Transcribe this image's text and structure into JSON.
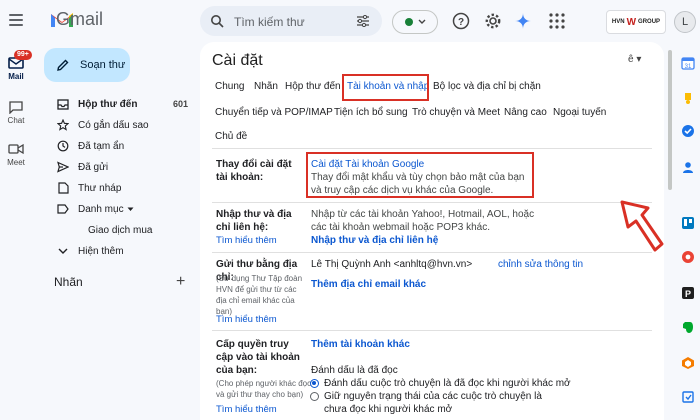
{
  "app": {
    "name": "Gmail"
  },
  "rail": {
    "mail_label": "Mail",
    "mail_badge": "99+",
    "chat_label": "Chat",
    "meet_label": "Meet"
  },
  "search": {
    "placeholder": "Tìm kiếm thư"
  },
  "brand": {
    "left": "HVN",
    "right": "GROUP"
  },
  "avatar": {
    "initial": "L"
  },
  "sidebar": {
    "compose": "Soạn thư",
    "items": [
      {
        "label": "Hộp thư đến",
        "count": "601",
        "icon": "inbox-icon"
      },
      {
        "label": "Có gắn dấu sao",
        "count": "",
        "icon": "star-icon"
      },
      {
        "label": "Đã tạm ẩn",
        "count": "",
        "icon": "clock-icon"
      },
      {
        "label": "Đã gửi",
        "count": "",
        "icon": "send-icon"
      },
      {
        "label": "Thư nháp",
        "count": "",
        "icon": "draft-icon"
      },
      {
        "label": "Danh mục",
        "count": "",
        "icon": "label-icon"
      },
      {
        "label": "Giao dịch mua",
        "count": "",
        "icon": "tag-icon"
      },
      {
        "label": "Hiện thêm",
        "count": "",
        "icon": "chevron-down-icon"
      }
    ],
    "labels_heading": "Nhãn"
  },
  "settings": {
    "title": "Cài đặt",
    "tabs_row1": [
      "Chung",
      "Nhãn",
      "Hộp thư đến",
      "Tài khoản và nhập",
      "Bộ lọc và địa chỉ bị chặn"
    ],
    "tabs_row2": [
      "Chuyển tiếp và POP/IMAP",
      "Tiện ích bổ sung",
      "Trò chuyện và Meet",
      "Nâng cao",
      "Ngoại tuyến"
    ],
    "tabs_row3": [
      "Chủ đề"
    ],
    "active_tab": "Tài khoản và nhập",
    "change_account": {
      "label": "Thay đổi cài đặt tài khoản:",
      "link": "Cài đặt Tài khoản Google",
      "desc": "Thay đổi mật khẩu và tùy chọn bảo mật của bạn và truy cập các dịch vụ khác của Google."
    },
    "import": {
      "label": "Nhập thư và địa chỉ liên hệ:",
      "learn_more": "Tìm hiểu thêm",
      "desc": "Nhập từ các tài khoản Yahoo!, Hotmail, AOL, hoặc các tài khoản webmail hoặc POP3 khác.",
      "action": "Nhập thư và địa chỉ liên hệ"
    },
    "send_as": {
      "label": "Gửi thư bằng địa chỉ:",
      "note": "(Sử dụng Thư Tập đoàn HVN để gửi thư từ các địa chỉ email khác của bạn)",
      "learn_more": "Tìm hiểu thêm",
      "identity": "Lê Thị Quỳnh Anh <anhltq@hvn.vn>",
      "edit": "chỉnh sửa thông tin",
      "add": "Thêm địa chỉ email khác"
    },
    "grant": {
      "label": "Cấp quyền truy cập vào tài khoản của bạn:",
      "note": "(Cho phép người khác đọc và gửi thư thay cho bạn)",
      "learn_more": "Tìm hiểu thêm",
      "add": "Thêm tài khoản khác",
      "mark_read": "Đánh dấu là đã đọc",
      "opt1": "Đánh dấu cuộc trò chuyện là đã đọc khi người khác mở",
      "opt2": "Giữ nguyên trạng thái của các cuộc trò chuyện là chưa đọc khi người khác mở"
    }
  },
  "colors": {
    "accent": "#0b57d0",
    "highlight": "#d93025",
    "compose_bg": "#c2e7ff",
    "page_bg": "#f6f8fc"
  }
}
